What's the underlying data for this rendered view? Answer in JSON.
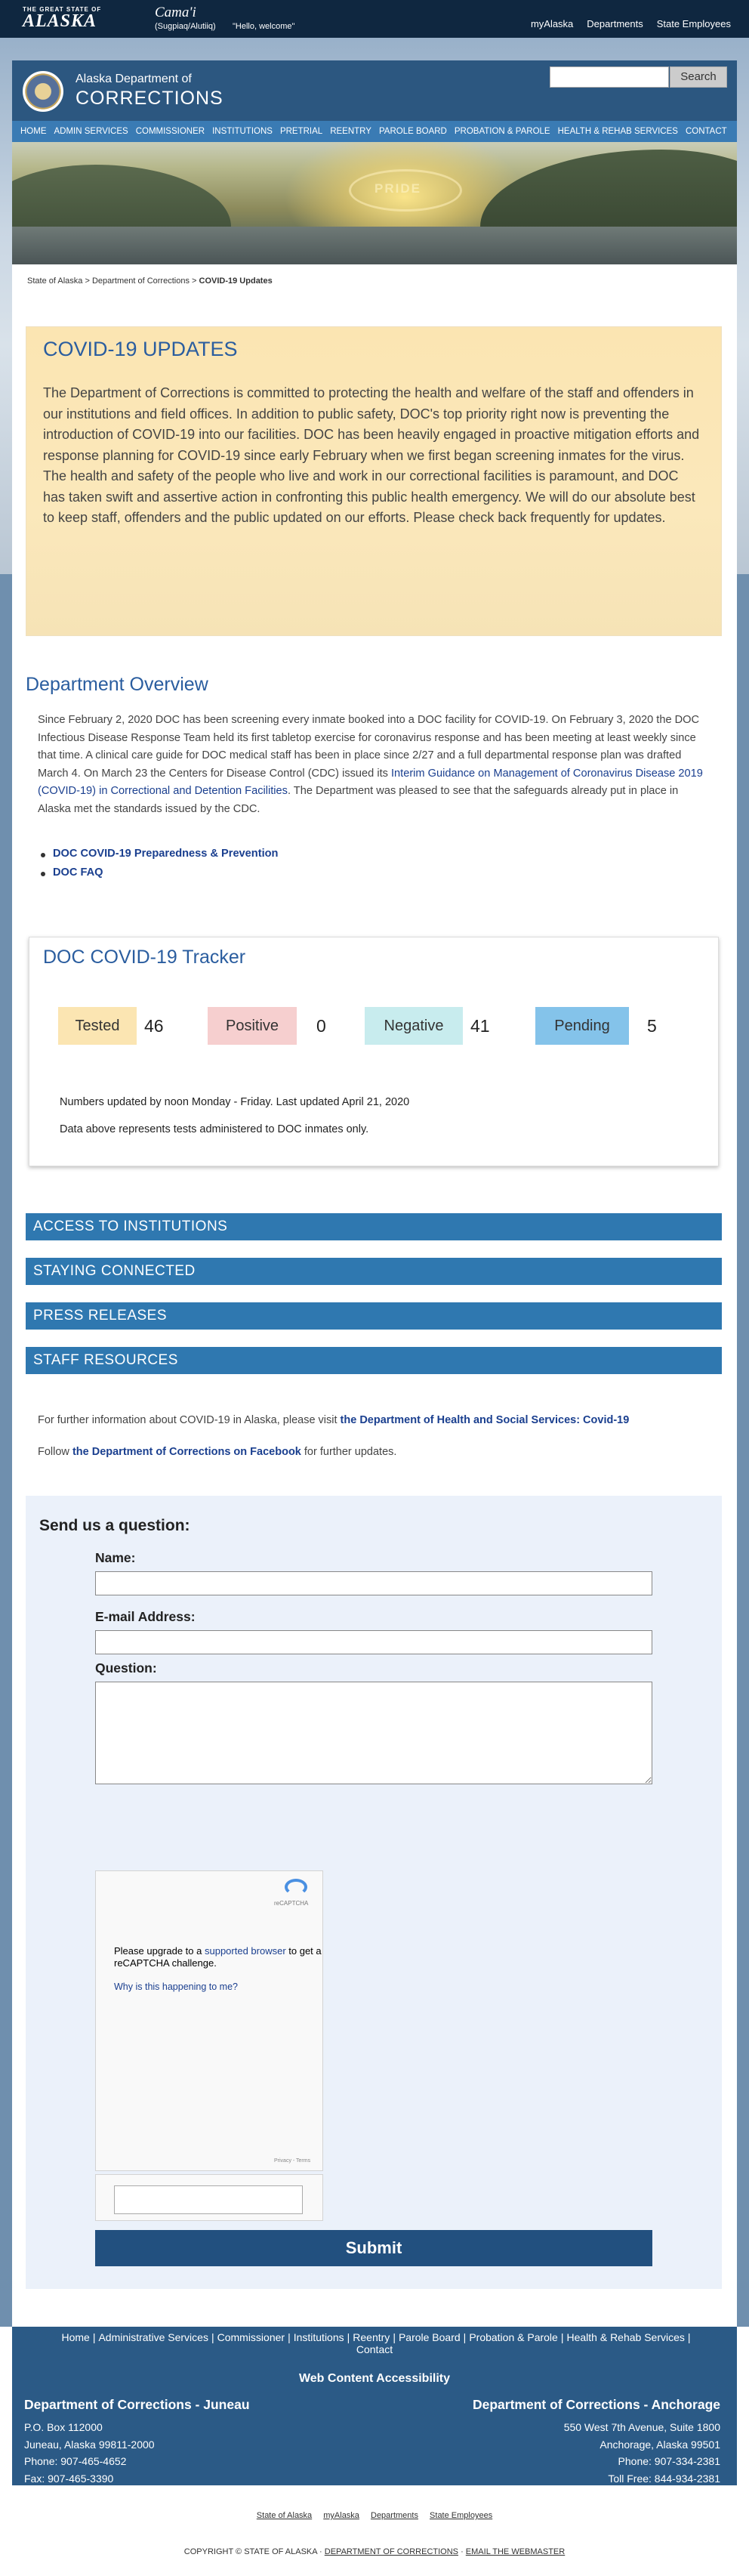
{
  "brand": {
    "small": "THE GREAT STATE OF",
    "big": "ALASKA"
  },
  "greeting": {
    "word": "Cama'i",
    "lang": "(Sugpiaq/Alutiiq)",
    "hello": "\"Hello, welcome\""
  },
  "top_links": [
    "myAlaska",
    "Departments",
    "State Employees"
  ],
  "org": {
    "line1": "Alaska Department of",
    "line2": "CORRECTIONS"
  },
  "search": {
    "placeholder": "",
    "button": "Search"
  },
  "nav": [
    "HOME",
    "ADMIN SERVICES",
    "COMMISSIONER",
    "INSTITUTIONS",
    "PRETRIAL",
    "REENTRY",
    "PAROLE BOARD",
    "PROBATION & PAROLE",
    "HEALTH & REHAB SERVICES",
    "CONTACT"
  ],
  "hero_text": "PRIDE",
  "breadcrumb": {
    "a": "State of Alaska",
    "sep": ">",
    "b": "Department of Corrections",
    "c": "COVID-19 Updates"
  },
  "updates": {
    "title": "COVID-19 UPDATES",
    "body": "The Department of Corrections is committed to protecting the health and welfare of the staff and offenders in our institutions and field offices. In addition to public safety, DOC's top priority right now is preventing the introduction of COVID-19 into our facilities. DOC has been heavily engaged in proactive mitigation efforts and response planning for COVID-19 since early February when we first began screening inmates for the virus. The health and safety of the people who live and work in our correctional facilities is paramount, and DOC has taken swift and assertive action in confronting this public health emergency. We will do our absolute best to keep staff, offenders and the public updated on our efforts. Please check back frequently for updates."
  },
  "overview": {
    "title": "Department Overview",
    "body_a": "Since February 2, 2020 DOC has been screening every inmate booked into a DOC facility for COVID-19. On February 3, 2020 the DOC Infectious Disease Response Team held its first tabletop exercise for coronavirus response and has been meeting at least weekly since that time. A clinical care guide for DOC medical staff has been in place since 2/27 and a full departmental response plan was drafted March 4. On March 23 the Centers for Disease Control (CDC) issued its ",
    "link": "Interim Guidance on Management of Coronavirus Disease 2019 (COVID-19) in Correctional and Detention Facilities",
    "body_b": ". The Department was pleased to see that the safeguards already put in place in Alaska met the standards issued by the CDC.",
    "links": [
      "DOC COVID-19 Preparedness & Prevention",
      "DOC FAQ"
    ]
  },
  "tracker": {
    "title": "DOC COVID-19 Tracker",
    "stats": [
      {
        "label": "Tested",
        "value": "46",
        "color": "#fbe5b2"
      },
      {
        "label": "Positive",
        "value": "0",
        "color": "#f6cfcf"
      },
      {
        "label": "Negative",
        "value": "41",
        "color": "#c8ecee"
      },
      {
        "label": "Pending",
        "value": "5",
        "color": "#84c3ea"
      }
    ],
    "note1": "Numbers updated by noon Monday - Friday. Last updated April 21, 2020",
    "note2": "Data above represents tests administered to DOC inmates only."
  },
  "accordion": [
    "ACCESS TO INSTITUTIONS",
    "STAYING CONNECTED",
    "PRESS RELEASES",
    "STAFF RESOURCES"
  ],
  "info": {
    "l1_pre": "For further information about COVID-19 in Alaska, please visit ",
    "l1_link": "the Department of Health and Social Services: Covid-19",
    "l2_pre": "Follow ",
    "l2_link": "the Department of Corrections on Facebook",
    "l2_post": " for further updates."
  },
  "form": {
    "title": "Send us a question:",
    "name_label": "Name:",
    "email_label": "E-mail Address:",
    "question_label": "Question:",
    "captcha_brand": "reCAPTCHA",
    "captcha_msg_a": "Please upgrade to a ",
    "captcha_msg_link": "supported browser",
    "captcha_msg_b": " to get a reCAPTCHA challenge.",
    "captcha_why": "Why is this happening to me?",
    "captcha_foot": "Privacy - Terms",
    "submit": "Submit"
  },
  "footer": {
    "nav": [
      "Home",
      "Administrative Services",
      "Commissioner",
      "Institutions",
      "Reentry",
      "Parole Board",
      "Probation & Parole",
      "Health & Rehab Services",
      "Contact"
    ],
    "accessibility": "Web Content Accessibility",
    "juneau": {
      "title": "Department of Corrections - Juneau",
      "l1": "P.O. Box 112000",
      "l2": "Juneau, Alaska 99811-2000",
      "l3": "Phone: 907-465-4652",
      "l4": "Fax: 907-465-3390"
    },
    "anchorage": {
      "title": "Department of Corrections - Anchorage",
      "l1": "550 West 7th Avenue, Suite 1800",
      "l2": "Anchorage, Alaska 99501",
      "l3": "Phone: 907-334-2381",
      "l4": "Toll Free: 844-934-2381"
    }
  },
  "bottom_links": [
    "State of Alaska",
    "myAlaska",
    "Departments",
    "State Employees"
  ],
  "copyright": {
    "a": "COPYRIGHT © STATE OF ALASKA · ",
    "b": "DEPARTMENT OF CORRECTIONS",
    "c": " · ",
    "d": "EMAIL THE WEBMASTER"
  }
}
